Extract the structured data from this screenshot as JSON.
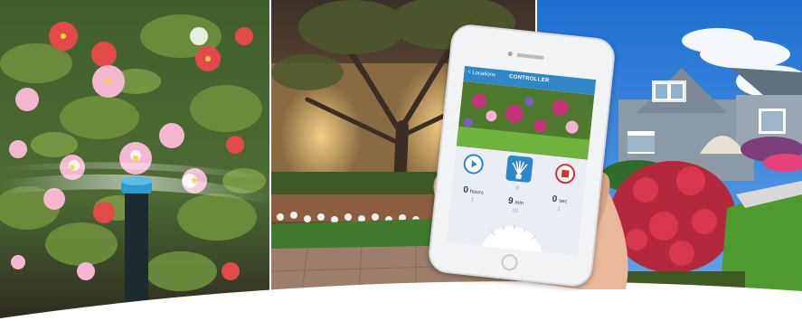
{
  "phone_screen": {
    "back_label": "< Locations",
    "title": "CONTROLLER",
    "timer": {
      "hours": {
        "value": "0",
        "label": "hours",
        "above": "",
        "below": "1"
      },
      "min": {
        "value": "9",
        "label": "min",
        "above": "8",
        "below": "10"
      },
      "sec": {
        "value": "0",
        "label": "sec",
        "above": "",
        "below": "1"
      }
    },
    "colors": {
      "header": "#2f86c8",
      "stop": "#d9302b"
    }
  },
  "icons": [
    "play-icon",
    "sprinkler-icon",
    "stop-icon"
  ]
}
